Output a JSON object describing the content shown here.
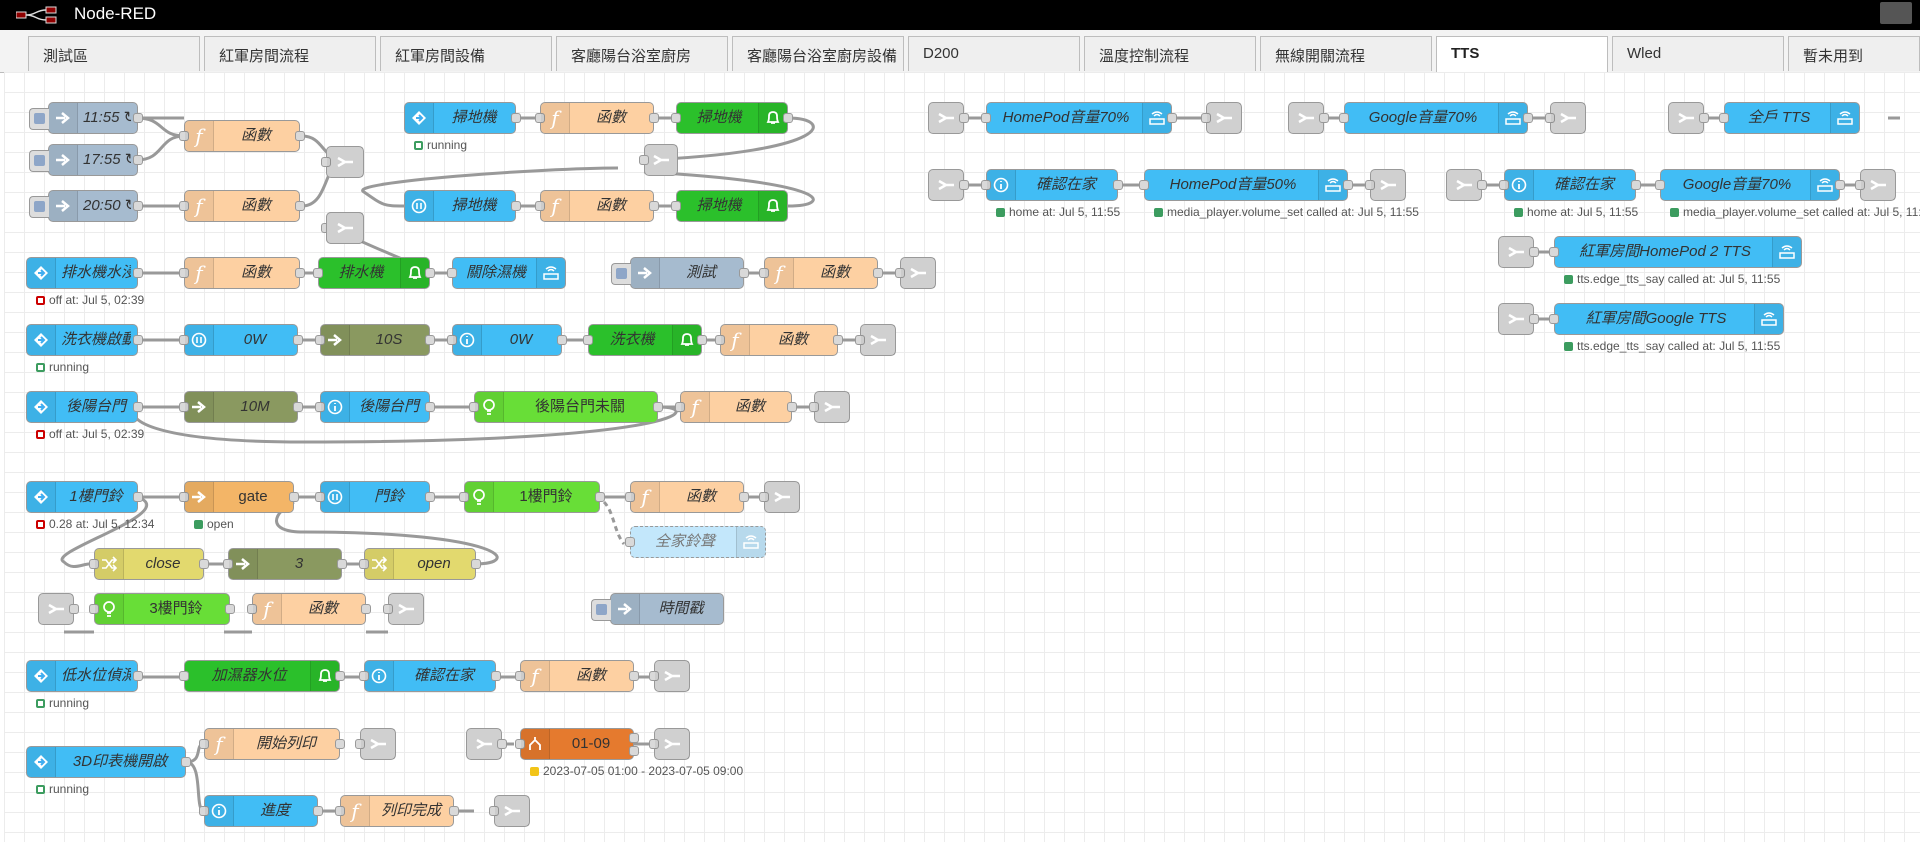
{
  "app": {
    "title": "Node-RED"
  },
  "tabs": [
    {
      "label": "測試區"
    },
    {
      "label": "紅軍房間流程"
    },
    {
      "label": "紅軍房間設備"
    },
    {
      "label": "客廳陽台浴室廚房"
    },
    {
      "label": "客廳陽台浴室廚房設備"
    },
    {
      "label": "D200"
    },
    {
      "label": "溫度控制流程"
    },
    {
      "label": "無線開關流程"
    },
    {
      "label": "TTS"
    },
    {
      "label": "Wled"
    },
    {
      "label": "暫未用到"
    }
  ],
  "nodes": {
    "inject_1155": "11:55 ↻",
    "inject_1755": "17:55 ↻",
    "inject_2050": "20:50 ↻",
    "func": "函數",
    "sweeper": "掃地機",
    "drain": "排水機水浸",
    "drain_out": "排水機",
    "dehumidifier": "關除濕機",
    "test": "測試",
    "washer_start": "洗衣機啟動",
    "watt": "0W",
    "sec10": "10S",
    "washer": "洗衣機",
    "back_door": "後陽台門",
    "min10": "10M",
    "back_door_open": "後陽台門未關",
    "door1": "1樓門鈴",
    "gate": "gate",
    "doorbell": "門鈴",
    "all_bell": "全家鈴聲",
    "close": "close",
    "three": "3",
    "open": "open",
    "door3": "3樓門鈴",
    "timestamp": "時間戳",
    "lowwater": "低水位偵測",
    "humid_level": "加濕器水位",
    "home_check": "確認在家",
    "printer_on": "3D印表機開啟",
    "print_start": "開始列印",
    "progress": "進度",
    "print_done": "列印完成",
    "time_range": "01-09",
    "hp70": "HomePod音量70%",
    "g70": "Google音量70%",
    "all_tts": "全戶 TTS",
    "hp50": "HomePod音量50%",
    "google70b": "Google音量70%",
    "red_hp": "紅軍房間HomePod 2 TTS",
    "red_g": "紅軍房間Google TTS"
  },
  "status": {
    "running": "running",
    "off_0239": "off at: Jul 5, 02:39",
    "val_028": "0.28 at: Jul 5, 12:34",
    "open": "open",
    "time_range": "2023-07-05 01:00 - 2023-07-05 09:00",
    "home": "home at: Jul 5, 11:55",
    "volume": "media_player.volume_set called at: Jul 5, 11:55",
    "tts": "tts.edge_tts_say called at: Jul 5, 11:55"
  },
  "colors": {
    "inject": "#a6bbcf",
    "function": "#fdd0a2",
    "home_assistant": "#41bdf5",
    "green": "#2bc02b",
    "light_green": "#68de37",
    "delay": "#8a9960",
    "link": "#dddddd",
    "change": "#e2d96e",
    "time_range": "#e57a2e",
    "gate": "#f3b567"
  },
  "icons": [
    "node-red-logo",
    "arrow-in-icon",
    "function-icon",
    "ha-event-icon",
    "bell-icon",
    "lightbulb-icon",
    "info-icon",
    "pause-icon",
    "wifi-icon",
    "link-icon",
    "shuffle-icon",
    "branch-icon"
  ]
}
